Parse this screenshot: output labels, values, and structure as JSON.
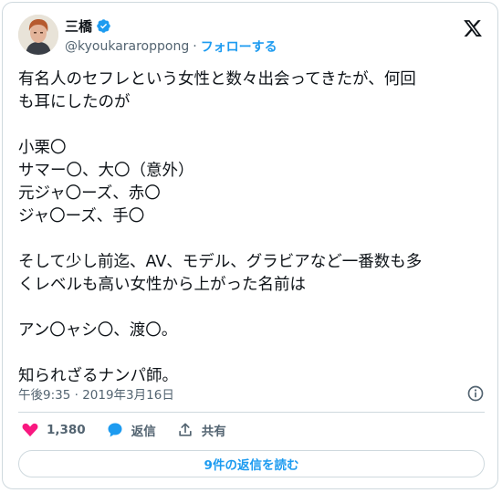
{
  "user": {
    "display_name": "三橋",
    "handle": "@kyoukararoppong",
    "separator": "·",
    "follow_label": "フォローする"
  },
  "tweet": {
    "text": "有名人のセフレという女性と数々出会ってきたが、何回\nも耳にしたのが\n\n小栗〇\nサマー〇、大〇（意外）\n元ジャ〇ーズ、赤〇\nジャ〇ーズ、手〇\n\nそして少し前迄、AV、モデル、グラビアなど一番数も多\nくレベルも高い女性から上がった名前は\n\nアン〇ャシ〇、渡〇。\n\n知られざるナンパ師。",
    "timestamp": "午後9:35 · 2019年3月16日"
  },
  "actions": {
    "like_count": "1,380",
    "reply_label": "返信",
    "share_label": "共有"
  },
  "replies_button": {
    "label": "9件の返信を読む"
  },
  "colors": {
    "accent": "#1d9bf0",
    "like": "#f91880",
    "text": "#0f1419",
    "muted": "#536471"
  },
  "icons": [
    "x-logo-icon",
    "verified-badge-icon",
    "info-icon",
    "heart-icon",
    "reply-bubble-icon",
    "share-icon"
  ]
}
